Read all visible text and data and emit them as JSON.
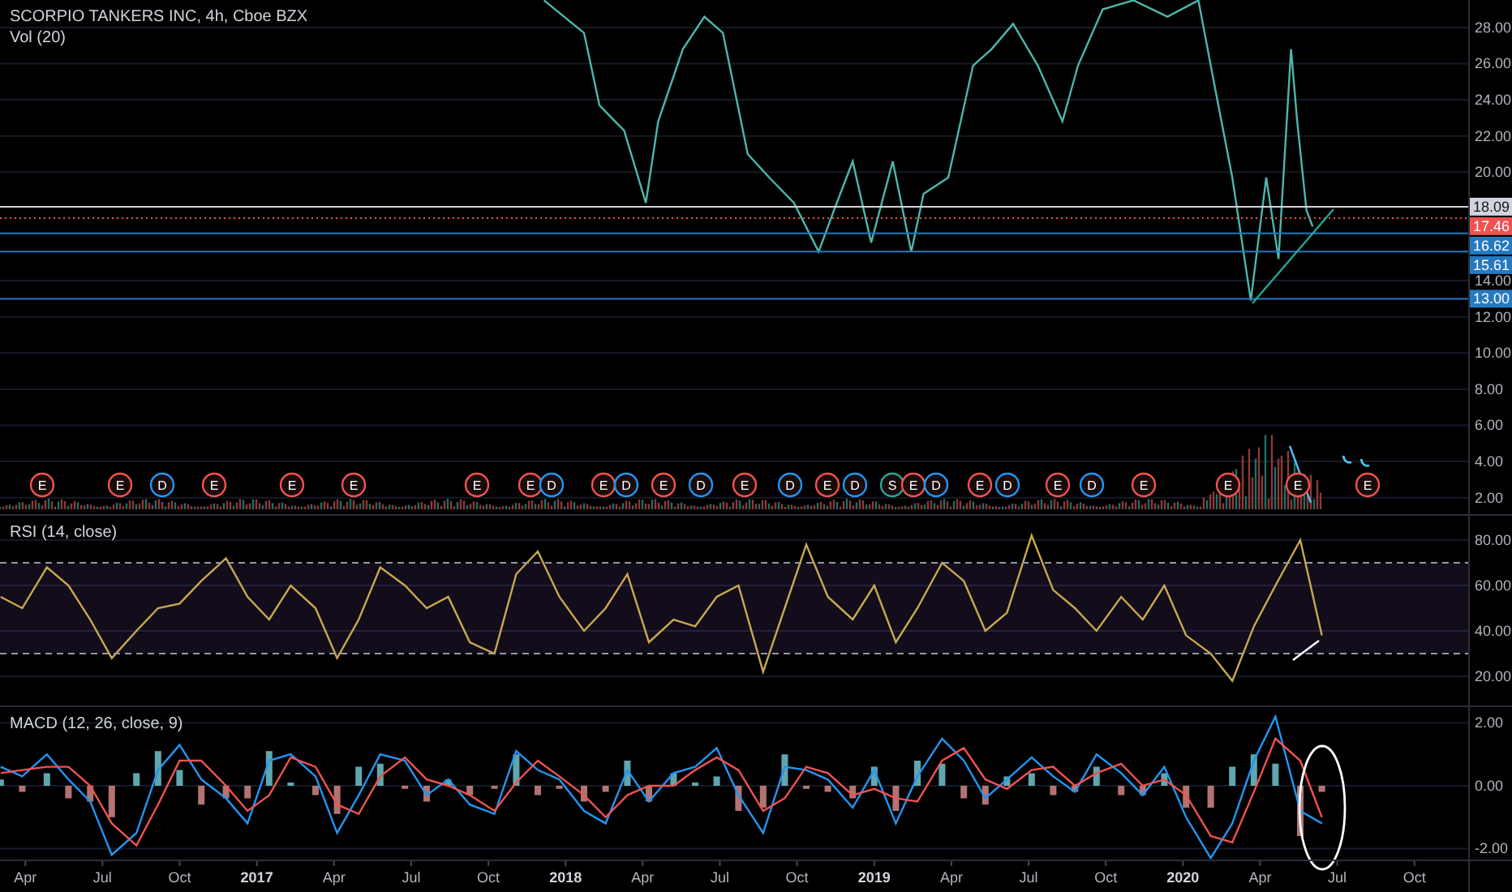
{
  "price_pane": {
    "chart_data": {
      "type": "line",
      "title": "SCORPIO TANKERS INC, 4h, Cboe BZX",
      "grid": true,
      "x": [
        2017.93,
        2018.06,
        2018.11,
        2018.19,
        2018.26,
        2018.3,
        2018.38,
        2018.45,
        2018.51,
        2018.59,
        2018.66,
        2018.74,
        2018.82,
        2018.87,
        2018.93,
        2018.99,
        2019.06,
        2019.12,
        2019.16,
        2019.24,
        2019.32,
        2019.38,
        2019.45,
        2019.53,
        2019.61,
        2019.66,
        2019.74,
        2019.84,
        2019.95,
        2020.05,
        2020.1,
        2020.16,
        2020.22,
        2020.27,
        2020.31,
        2020.35,
        2020.37,
        2020.4,
        2020.42
      ],
      "series": [
        {
          "color": "#4db6ac",
          "values": [
            29.5,
            27.7,
            23.7,
            22.3,
            18.3,
            22.8,
            26.8,
            28.6,
            27.7,
            21.0,
            19.7,
            18.3,
            15.6,
            17.9,
            20.6,
            16.1,
            20.6,
            15.6,
            18.8,
            19.7,
            25.9,
            26.8,
            28.2,
            25.9,
            22.8,
            25.9,
            29.0,
            29.5,
            28.6,
            29.5,
            25.0,
            19.7,
            12.9,
            19.7,
            15.2,
            26.8,
            22.8,
            17.9,
            17.0
          ]
        }
      ],
      "xlim": [
        2016.168,
        2021.066
      ],
      "ylim": [
        1.0,
        29.52
      ],
      "yticks": [
        {
          "value": 2,
          "label": "2.00"
        },
        {
          "value": 4,
          "label": "4.00"
        },
        {
          "value": 6,
          "label": "6.00"
        },
        {
          "value": 8,
          "label": "8.00"
        },
        {
          "value": 10,
          "label": "10.00"
        },
        {
          "value": 12,
          "label": "12.00"
        },
        {
          "value": 14,
          "label": "14.00"
        },
        {
          "value": 20,
          "label": "20.00"
        },
        {
          "value": 22,
          "label": "22.00"
        },
        {
          "value": 24,
          "label": "24.00"
        },
        {
          "value": 26,
          "label": "26.00"
        },
        {
          "value": 28,
          "label": "28.00"
        }
      ],
      "ref_lines": [
        {
          "axis": "y",
          "value": 18.09,
          "label": "18.09",
          "color": "#d1d4dc"
        },
        {
          "axis": "y",
          "value": 17.46,
          "label": "17.46",
          "color": "#ef5350"
        },
        {
          "axis": "y",
          "value": 16.62,
          "label": "16.62",
          "color": "#2679c0"
        },
        {
          "axis": "y",
          "value": 15.61,
          "label": "15.61",
          "color": "#2679c0"
        },
        {
          "axis": "y",
          "value": 13.0,
          "label": "13.00",
          "color": "#2679c0"
        }
      ]
    },
    "volume": {
      "label": "Vol (20)"
    },
    "events": [
      {
        "label": "E",
        "color": "#ef5350"
      },
      {
        "label": "E",
        "color": "#ef5350"
      },
      {
        "label": "D",
        "color": "#2196f3"
      },
      {
        "label": "E",
        "color": "#ef5350"
      },
      {
        "label": "E",
        "color": "#ef5350"
      },
      {
        "label": "E",
        "color": "#ef5350"
      },
      {
        "label": "E",
        "color": "#ef5350"
      },
      {
        "label": "E",
        "color": "#ef5350"
      },
      {
        "label": "D",
        "color": "#2196f3"
      },
      {
        "label": "E",
        "color": "#ef5350"
      },
      {
        "label": "D",
        "color": "#2196f3"
      },
      {
        "label": "E",
        "color": "#ef5350"
      },
      {
        "label": "D",
        "color": "#2196f3"
      },
      {
        "label": "E",
        "color": "#ef5350"
      },
      {
        "label": "D",
        "color": "#2196f3"
      },
      {
        "label": "E",
        "color": "#ef5350"
      },
      {
        "label": "D",
        "color": "#2196f3"
      },
      {
        "label": "S",
        "color": "#26a69a"
      },
      {
        "label": "E",
        "color": "#ef5350"
      },
      {
        "label": "D",
        "color": "#2196f3"
      },
      {
        "label": "E",
        "color": "#ef5350"
      },
      {
        "label": "D",
        "color": "#2196f3"
      },
      {
        "label": "E",
        "color": "#ef5350"
      },
      {
        "label": "D",
        "color": "#2196f3"
      },
      {
        "label": "E",
        "color": "#ef5350"
      },
      {
        "label": "E",
        "color": "#ef5350"
      },
      {
        "label": "E",
        "color": "#ef5350"
      },
      {
        "label": "E",
        "color": "#ef5350"
      }
    ]
  },
  "rsi_pane": {
    "chart_data": {
      "type": "line",
      "title": "RSI (14, close)",
      "grid": true,
      "x": [
        2016.17,
        2016.24,
        2016.32,
        2016.39,
        2016.46,
        2016.53,
        2016.61,
        2016.68,
        2016.75,
        2016.82,
        2016.9,
        2016.97,
        2017.04,
        2017.11,
        2017.19,
        2017.26,
        2017.33,
        2017.4,
        2017.48,
        2017.55,
        2017.62,
        2017.69,
        2017.77,
        2017.84,
        2017.91,
        2017.98,
        2018.06,
        2018.13,
        2018.2,
        2018.27,
        2018.35,
        2018.42,
        2018.49,
        2018.56,
        2018.64,
        2018.71,
        2018.78,
        2018.85,
        2018.93,
        2019.0,
        2019.07,
        2019.14,
        2019.22,
        2019.29,
        2019.36,
        2019.43,
        2019.51,
        2019.58,
        2019.65,
        2019.72,
        2019.8,
        2019.87,
        2019.94,
        2020.01,
        2020.09,
        2020.16,
        2020.23,
        2020.3,
        2020.38,
        2020.45
      ],
      "series": [
        {
          "color": "#c9a94e",
          "values": [
            55,
            50,
            68,
            60,
            45,
            28,
            40,
            50,
            52,
            62,
            72,
            55,
            45,
            60,
            50,
            28,
            45,
            68,
            60,
            50,
            55,
            35,
            30,
            65,
            75,
            55,
            40,
            50,
            65,
            35,
            45,
            42,
            55,
            60,
            22,
            50,
            78,
            55,
            45,
            60,
            35,
            50,
            70,
            62,
            40,
            48,
            82,
            58,
            50,
            40,
            55,
            45,
            60,
            38,
            30,
            18,
            42,
            60,
            80,
            38
          ]
        }
      ],
      "xlim": [
        2016.168,
        2021.066
      ],
      "ylim": [
        6.4,
        90.7
      ],
      "yticks": [
        {
          "value": 20,
          "label": "20.00"
        },
        {
          "value": 40,
          "label": "40.00"
        },
        {
          "value": 60,
          "label": "60.00"
        },
        {
          "value": 80,
          "label": "80.00"
        }
      ],
      "ref_lines": [
        {
          "axis": "y",
          "value": 70,
          "color": "#9598a1"
        },
        {
          "axis": "y",
          "value": 30,
          "color": "#9598a1"
        }
      ]
    }
  },
  "macd_pane": {
    "chart_data": {
      "type": "line",
      "title": "MACD (12, 26, close, 9)",
      "grid": true,
      "x": [
        2016.17,
        2016.24,
        2016.32,
        2016.39,
        2016.46,
        2016.53,
        2016.61,
        2016.68,
        2016.75,
        2016.82,
        2016.9,
        2016.97,
        2017.04,
        2017.11,
        2017.19,
        2017.26,
        2017.33,
        2017.4,
        2017.48,
        2017.55,
        2017.62,
        2017.69,
        2017.77,
        2017.84,
        2017.91,
        2017.98,
        2018.06,
        2018.13,
        2018.2,
        2018.27,
        2018.35,
        2018.42,
        2018.49,
        2018.56,
        2018.64,
        2018.71,
        2018.78,
        2018.85,
        2018.93,
        2019.0,
        2019.07,
        2019.14,
        2019.22,
        2019.29,
        2019.36,
        2019.43,
        2019.51,
        2019.58,
        2019.65,
        2019.72,
        2019.8,
        2019.87,
        2019.94,
        2020.01,
        2020.09,
        2020.16,
        2020.23,
        2020.3,
        2020.38,
        2020.45
      ],
      "series": [
        {
          "color": "#2196f3",
          "values": [
            0.6,
            0.3,
            1.0,
            0.2,
            -0.5,
            -2.2,
            -1.5,
            0.5,
            1.3,
            0.2,
            -0.4,
            -1.2,
            0.8,
            1.0,
            0.3,
            -1.5,
            -0.3,
            1.0,
            0.8,
            -0.3,
            0.2,
            -0.6,
            -0.9,
            1.1,
            0.5,
            0.2,
            -0.8,
            -1.2,
            0.5,
            -0.5,
            0.4,
            0.6,
            1.2,
            -0.3,
            -1.5,
            0.6,
            0.5,
            0.2,
            -0.7,
            0.5,
            -1.2,
            0.3,
            1.5,
            0.8,
            -0.4,
            0.2,
            0.9,
            0.3,
            -0.2,
            1.0,
            0.4,
            -0.3,
            0.6,
            -1.0,
            -2.3,
            -1.2,
            0.8,
            2.2,
            -0.8,
            -1.2
          ]
        },
        {
          "color": "#ef5350",
          "values": [
            0.4,
            0.5,
            0.6,
            0.6,
            0.0,
            -1.2,
            -1.9,
            -0.6,
            0.8,
            0.8,
            0.0,
            -0.8,
            -0.3,
            0.9,
            0.6,
            -0.6,
            -0.9,
            0.3,
            0.9,
            0.2,
            0.0,
            -0.3,
            -0.8,
            0.1,
            0.8,
            0.3,
            -0.3,
            -1.0,
            -0.3,
            0.0,
            0.0,
            0.5,
            0.9,
            0.5,
            -0.8,
            -0.4,
            0.6,
            0.4,
            -0.3,
            -0.1,
            -0.4,
            -0.5,
            0.8,
            1.2,
            0.2,
            -0.1,
            0.5,
            0.6,
            0.0,
            0.4,
            0.7,
            0.0,
            0.2,
            -0.3,
            -1.6,
            -1.8,
            -0.2,
            1.5,
            0.8,
            -1.0
          ]
        }
      ],
      "xlim": [
        2016.168,
        2021.066
      ],
      "ylim": [
        -2.4,
        2.5
      ],
      "yticks": [
        {
          "value": -2,
          "label": "-2.00"
        },
        {
          "value": 0,
          "label": "0.00"
        },
        {
          "value": 2,
          "label": "2.00"
        }
      ],
      "xticks": [
        {
          "value": 2016.25,
          "label": "Apr"
        },
        {
          "value": 2016.5,
          "label": "Jul"
        },
        {
          "value": 2016.75,
          "label": "Oct"
        },
        {
          "value": 2017,
          "label": "2017"
        },
        {
          "value": 2017.25,
          "label": "Apr"
        },
        {
          "value": 2017.5,
          "label": "Jul"
        },
        {
          "value": 2017.75,
          "label": "Oct"
        },
        {
          "value": 2018,
          "label": "2018"
        },
        {
          "value": 2018.25,
          "label": "Apr"
        },
        {
          "value": 2018.5,
          "label": "Jul"
        },
        {
          "value": 2018.75,
          "label": "Oct"
        },
        {
          "value": 2019,
          "label": "2019"
        },
        {
          "value": 2019.25,
          "label": "Apr"
        },
        {
          "value": 2019.5,
          "label": "Jul"
        },
        {
          "value": 2019.75,
          "label": "Oct"
        },
        {
          "value": 2020,
          "label": "2020"
        },
        {
          "value": 2020.25,
          "label": "Apr"
        },
        {
          "value": 2020.5,
          "label": "Jul"
        },
        {
          "value": 2020.75,
          "label": "Oct"
        }
      ]
    }
  }
}
